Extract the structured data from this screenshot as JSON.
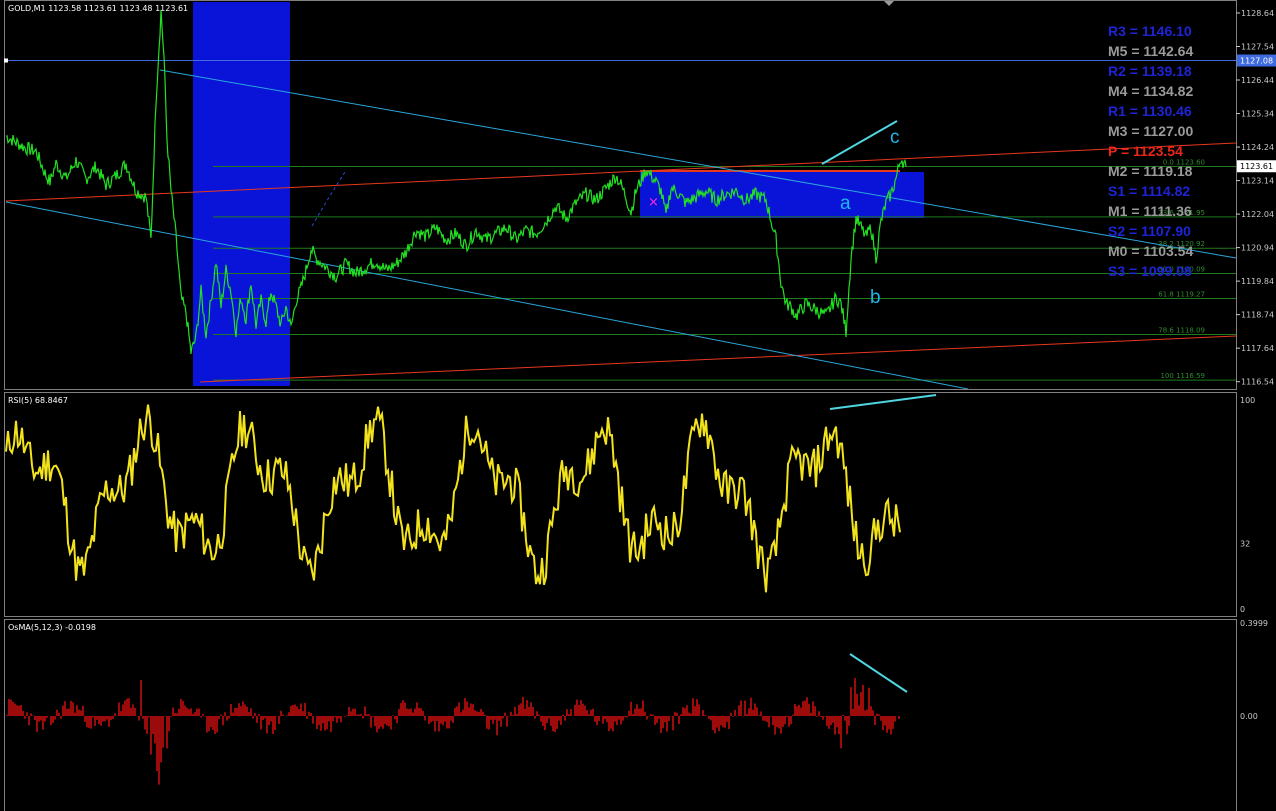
{
  "chart_data": [
    {
      "type": "line",
      "title": "GOLD,M1  1123.58 1123.61 1123.48 1123.61",
      "price_axis": {
        "ylim": [
          1116.3,
          1129.0
        ],
        "ticks": [
          "1128.64",
          "1127.54",
          "1126.44",
          "1125.34",
          "1124.24",
          "1123.14",
          "1122.04",
          "1120.94",
          "1119.84",
          "1118.74",
          "1117.64",
          "1116.54"
        ],
        "current_price": "1123.61",
        "line_price": "1127.08"
      },
      "pivots": [
        {
          "label": "R3 = 1146.10",
          "color": "#1e24d6"
        },
        {
          "label": "M5 = 1142.64",
          "color": "#9a9a9a"
        },
        {
          "label": "R2 = 1139.18",
          "color": "#1e24d6"
        },
        {
          "label": "M4 = 1134.82",
          "color": "#9a9a9a"
        },
        {
          "label": "R1 = 1130.46",
          "color": "#1e24d6"
        },
        {
          "label": "M3 = 1127.00",
          "color": "#9a9a9a"
        },
        {
          "label": "P  = 1123.54",
          "color": "#e8261c"
        },
        {
          "label": "M2 = 1119.18",
          "color": "#9a9a9a"
        },
        {
          "label": "S1 = 1114.82",
          "color": "#1e24d6"
        },
        {
          "label": "M1 = 1111.36",
          "color": "#9a9a9a"
        },
        {
          "label": "S2 = 1107.90",
          "color": "#1e24d6"
        },
        {
          "label": "M0 = 1103.54",
          "color": "#9a9a9a"
        },
        {
          "label": "S3 = 1099.08",
          "color": "#1e24d6"
        }
      ],
      "fib_levels": [
        {
          "label": "0.0 1123.60",
          "price": 1123.6
        },
        {
          "label": "23.6 1121.95",
          "price": 1121.95
        },
        {
          "label": "38.2 1120.92",
          "price": 1120.92
        },
        {
          "label": "50.0 1120.09",
          "price": 1120.09
        },
        {
          "label": "61.8 1119.27",
          "price": 1119.27
        },
        {
          "label": "78.6 1118.09",
          "price": 1118.09
        },
        {
          "label": "100 1116.59",
          "price": 1116.59
        }
      ],
      "wave_labels": [
        "a",
        "b",
        "c"
      ],
      "series": [
        {
          "x": [
            0,
            10,
            20,
            30,
            40,
            44,
            50,
            60,
            70,
            80,
            90,
            100,
            110,
            120,
            130,
            140,
            145,
            150,
            155,
            158,
            161,
            165,
            170,
            175,
            180,
            185,
            190,
            195,
            200,
            205,
            210,
            215,
            220,
            225,
            230,
            235,
            240,
            245,
            250,
            255,
            260,
            265,
            270,
            275,
            280,
            285,
            290,
            295,
            300,
            305,
            310,
            320,
            330,
            340,
            350,
            360,
            370,
            380,
            390,
            400,
            410,
            420,
            430,
            440,
            450,
            460,
            470,
            480,
            490,
            500,
            510,
            520,
            530,
            540,
            550,
            560,
            570,
            580,
            590,
            600,
            610,
            615,
            620,
            625,
            630,
            640,
            650,
            655,
            660,
            665,
            670,
            680,
            690,
            700,
            710,
            720,
            730,
            740,
            750,
            760,
            770,
            775,
            780,
            785,
            790,
            800,
            810,
            820,
            830,
            835,
            840,
            845,
            850,
            860,
            865,
            870,
            875,
            880,
            885,
            890,
            895,
            900
          ],
          "y": [
            1124.6,
            1124.4,
            1124.2,
            1124.1,
            1123.3,
            1123.1,
            1123.7,
            1123.2,
            1123.8,
            1123.2,
            1123.6,
            1123.0,
            1123.3,
            1123.7,
            1122.8,
            1122.6,
            1121.2,
            1125.8,
            1128.7,
            1127.2,
            1124.5,
            1122.8,
            1121.3,
            1119.3,
            1118.8,
            1117.5,
            1118.0,
            1119.5,
            1118.1,
            1119.2,
            1120.5,
            1119.0,
            1120.2,
            1119.5,
            1118.2,
            1119.3,
            1118.6,
            1119.8,
            1118.4,
            1119.2,
            1118.5,
            1119.5,
            1119.0,
            1118.4,
            1119.0,
            1118.3,
            1119.2,
            1119.6,
            1120.2,
            1120.9,
            1120.6,
            1120.3,
            1120.0,
            1120.4,
            1120.1,
            1120.3,
            1120.5,
            1120.2,
            1120.4,
            1120.8,
            1121.5,
            1121.3,
            1121.6,
            1121.2,
            1121.4,
            1121.0,
            1121.5,
            1121.2,
            1121.4,
            1121.6,
            1121.2,
            1121.5,
            1121.4,
            1121.8,
            1122.3,
            1121.9,
            1122.4,
            1122.7,
            1122.5,
            1122.9,
            1123.3,
            1123.0,
            1122.6,
            1122.1,
            1122.8,
            1123.5,
            1123.1,
            1122.8,
            1122.0,
            1122.9,
            1122.8,
            1122.4,
            1122.6,
            1122.8,
            1122.5,
            1122.7,
            1122.8,
            1122.5,
            1122.7,
            1122.5,
            1121.2,
            1119.8,
            1119.1,
            1119.0,
            1118.7,
            1119.1,
            1118.9,
            1118.7,
            1119.3,
            1119.1,
            1118.2,
            1120.6,
            1121.9,
            1121.3,
            1121.6,
            1120.6,
            1121.8,
            1122.4,
            1122.7,
            1123.2,
            1123.9,
            1123.6
          ]
        }
      ]
    },
    {
      "type": "line",
      "title": "RSI(5) 68.8467",
      "ylim": [
        0,
        100
      ],
      "ticks": [
        "100",
        "32",
        "0"
      ]
    },
    {
      "type": "bar",
      "title": "OsMA(5,12,3) -0.0198",
      "ticks": [
        "0.3999",
        "0.00"
      ]
    }
  ]
}
